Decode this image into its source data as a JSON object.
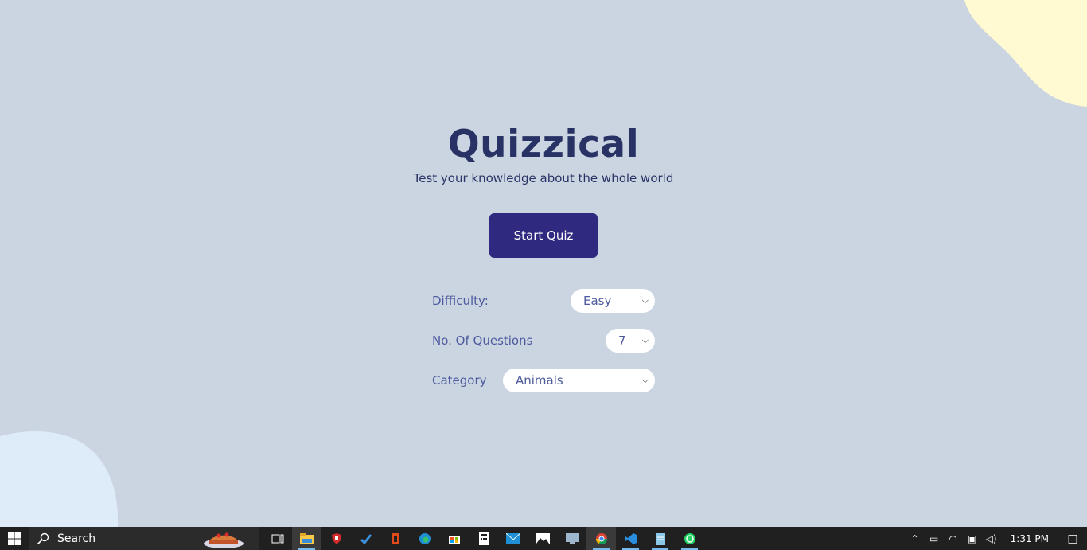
{
  "app": {
    "title": "Quizzical",
    "subtitle": "Test your knowledge about the whole world",
    "start_label": "Start Quiz"
  },
  "settings": {
    "difficulty_label": "Difficulty:",
    "difficulty_value": "Easy",
    "questions_label": "No. Of Questions",
    "questions_value": "7",
    "category_label": "Category",
    "category_value": "Animals"
  },
  "colors": {
    "background": "#cbd5e1",
    "title": "#293264",
    "button": "#2f2a80",
    "blob_top_right": "#fffad1",
    "blob_bottom_left": "#deebf8"
  },
  "taskbar": {
    "search_label": "Search",
    "clock": "1:31 PM",
    "apps": [
      "task-view-icon",
      "file-explorer-icon",
      "shield-app-icon",
      "todo-icon",
      "office-icon",
      "edge-icon",
      "store-icon",
      "calculator-icon",
      "mail-icon",
      "photos-icon",
      "remote-desktop-icon",
      "chrome-icon",
      "vscode-icon",
      "notepad-icon",
      "whatsapp-icon"
    ]
  }
}
